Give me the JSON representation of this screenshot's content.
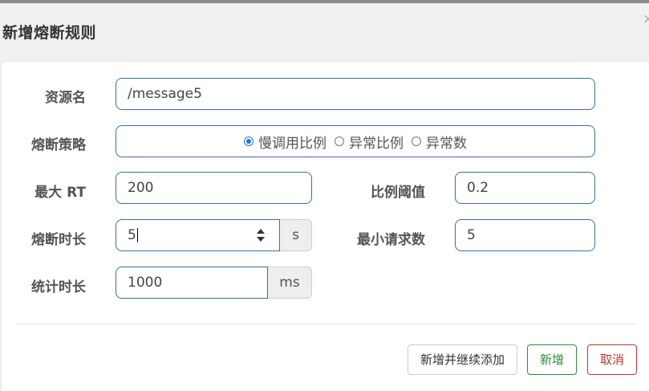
{
  "dialog": {
    "title": "新增熔断规则",
    "close_label": "×"
  },
  "form": {
    "resource_label": "资源名",
    "resource_value": "/message5",
    "strategy_label": "熔断策略",
    "strategy_options": [
      "慢调用比例",
      "异常比例",
      "异常数"
    ],
    "strategy_selected": "慢调用比例",
    "max_rt_label": "最大 RT",
    "max_rt_value": "200",
    "ratio_label": "比例阈值",
    "ratio_value": "0.2",
    "duration_label": "熔断时长",
    "duration_value": "5",
    "duration_unit": "s",
    "min_request_label": "最小请求数",
    "min_request_value": "5",
    "stat_label": "统计时长",
    "stat_value": "1000",
    "stat_unit": "ms"
  },
  "footer": {
    "add_continue_label": "新增并继续添加",
    "add_label": "新增",
    "cancel_label": "取消"
  },
  "colors": {
    "input_border": "#3c6ea3",
    "radio_accent": "#1a73e8",
    "success": "#2e8b3a",
    "danger": "#c9302c"
  }
}
